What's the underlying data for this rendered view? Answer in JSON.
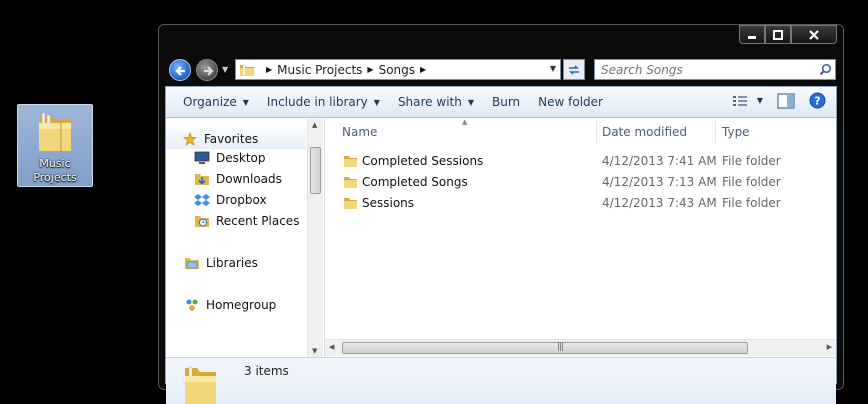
{
  "desktop": {
    "icon_label": "Music\nProjects",
    "icon_label_line1": "Music",
    "icon_label_line2": "Projects"
  },
  "window": {
    "caption": {
      "minimize": "—",
      "maximize": "☐",
      "close": "✕"
    },
    "breadcrumb": [
      "Music Projects",
      "Songs"
    ],
    "search": {
      "placeholder": "Search Songs"
    }
  },
  "toolbar": {
    "organize": "Organize",
    "include_in_library": "Include in library",
    "share_with": "Share with",
    "burn": "Burn",
    "new_folder": "New folder"
  },
  "navpane": {
    "favorites": "Favorites",
    "items": [
      "Desktop",
      "Downloads",
      "Dropbox",
      "Recent Places"
    ],
    "libraries": "Libraries",
    "homegroup": "Homegroup"
  },
  "filelist": {
    "columns": {
      "name": "Name",
      "date": "Date modified",
      "type": "Type"
    },
    "rows": [
      {
        "name": "Completed Sessions",
        "date": "4/12/2013 7:41 AM",
        "type": "File folder"
      },
      {
        "name": "Completed Songs",
        "date": "4/12/2013 7:13 AM",
        "type": "File folder"
      },
      {
        "name": "Sessions",
        "date": "4/12/2013 7:43 AM",
        "type": "File folder"
      }
    ]
  },
  "details": {
    "count": "3 items"
  },
  "colors": {
    "accent": "#1e395b",
    "selection": "#7f9fc8",
    "folder": "#e8c35a"
  }
}
